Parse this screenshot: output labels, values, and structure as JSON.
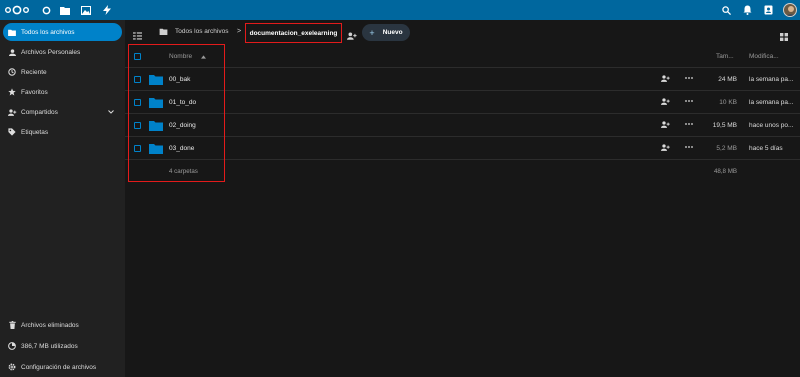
{
  "header": {
    "apps": [
      "dashboard-icon",
      "files-icon",
      "photos-icon",
      "activity-icon"
    ],
    "right_icons": [
      "search-icon",
      "notifications-icon",
      "contacts-icon"
    ]
  },
  "sidebar": {
    "items": [
      {
        "label": "Todos los archivos",
        "icon": "folder-icon",
        "active": true
      },
      {
        "label": "Archivos Personales",
        "icon": "user-icon"
      },
      {
        "label": "Reciente",
        "icon": "clock-icon"
      },
      {
        "label": "Favoritos",
        "icon": "star-icon"
      },
      {
        "label": "Compartidos",
        "icon": "share-icon"
      },
      {
        "label": "Etiquetas",
        "icon": "tag-icon"
      }
    ],
    "footer": [
      {
        "label": "Archivos eliminados",
        "icon": "trash-icon"
      },
      {
        "label": "386,7 MB utilizados",
        "icon": "pie-icon"
      },
      {
        "label": "Configuración de archivos",
        "icon": "gear-icon"
      }
    ]
  },
  "breadcrumb": {
    "home": "Todos los archivos",
    "separator": ">",
    "current": "documentacion_exelearning"
  },
  "toolbar": {
    "new_label": "Nuevo"
  },
  "table": {
    "headers": {
      "name": "Nombre",
      "size": "Tam...",
      "modified": "Modifica..."
    },
    "rows": [
      {
        "name": "00_bak",
        "size": "24 MB",
        "modified": "la semana pa..."
      },
      {
        "name": "01_to_do",
        "size": "10 KB",
        "modified": "la semana pa..."
      },
      {
        "name": "02_doing",
        "size": "19,5 MB",
        "modified": "hace unos po..."
      },
      {
        "name": "03_done",
        "size": "5,2 MB",
        "modified": "hace 5 días"
      }
    ],
    "summary": {
      "count": "4 carpetas",
      "total": "48,8 MB"
    }
  },
  "colors": {
    "header_bg": "#00679e",
    "accent": "#0082c9",
    "folder": "#0082c9",
    "highlight": "#e31b1b"
  }
}
